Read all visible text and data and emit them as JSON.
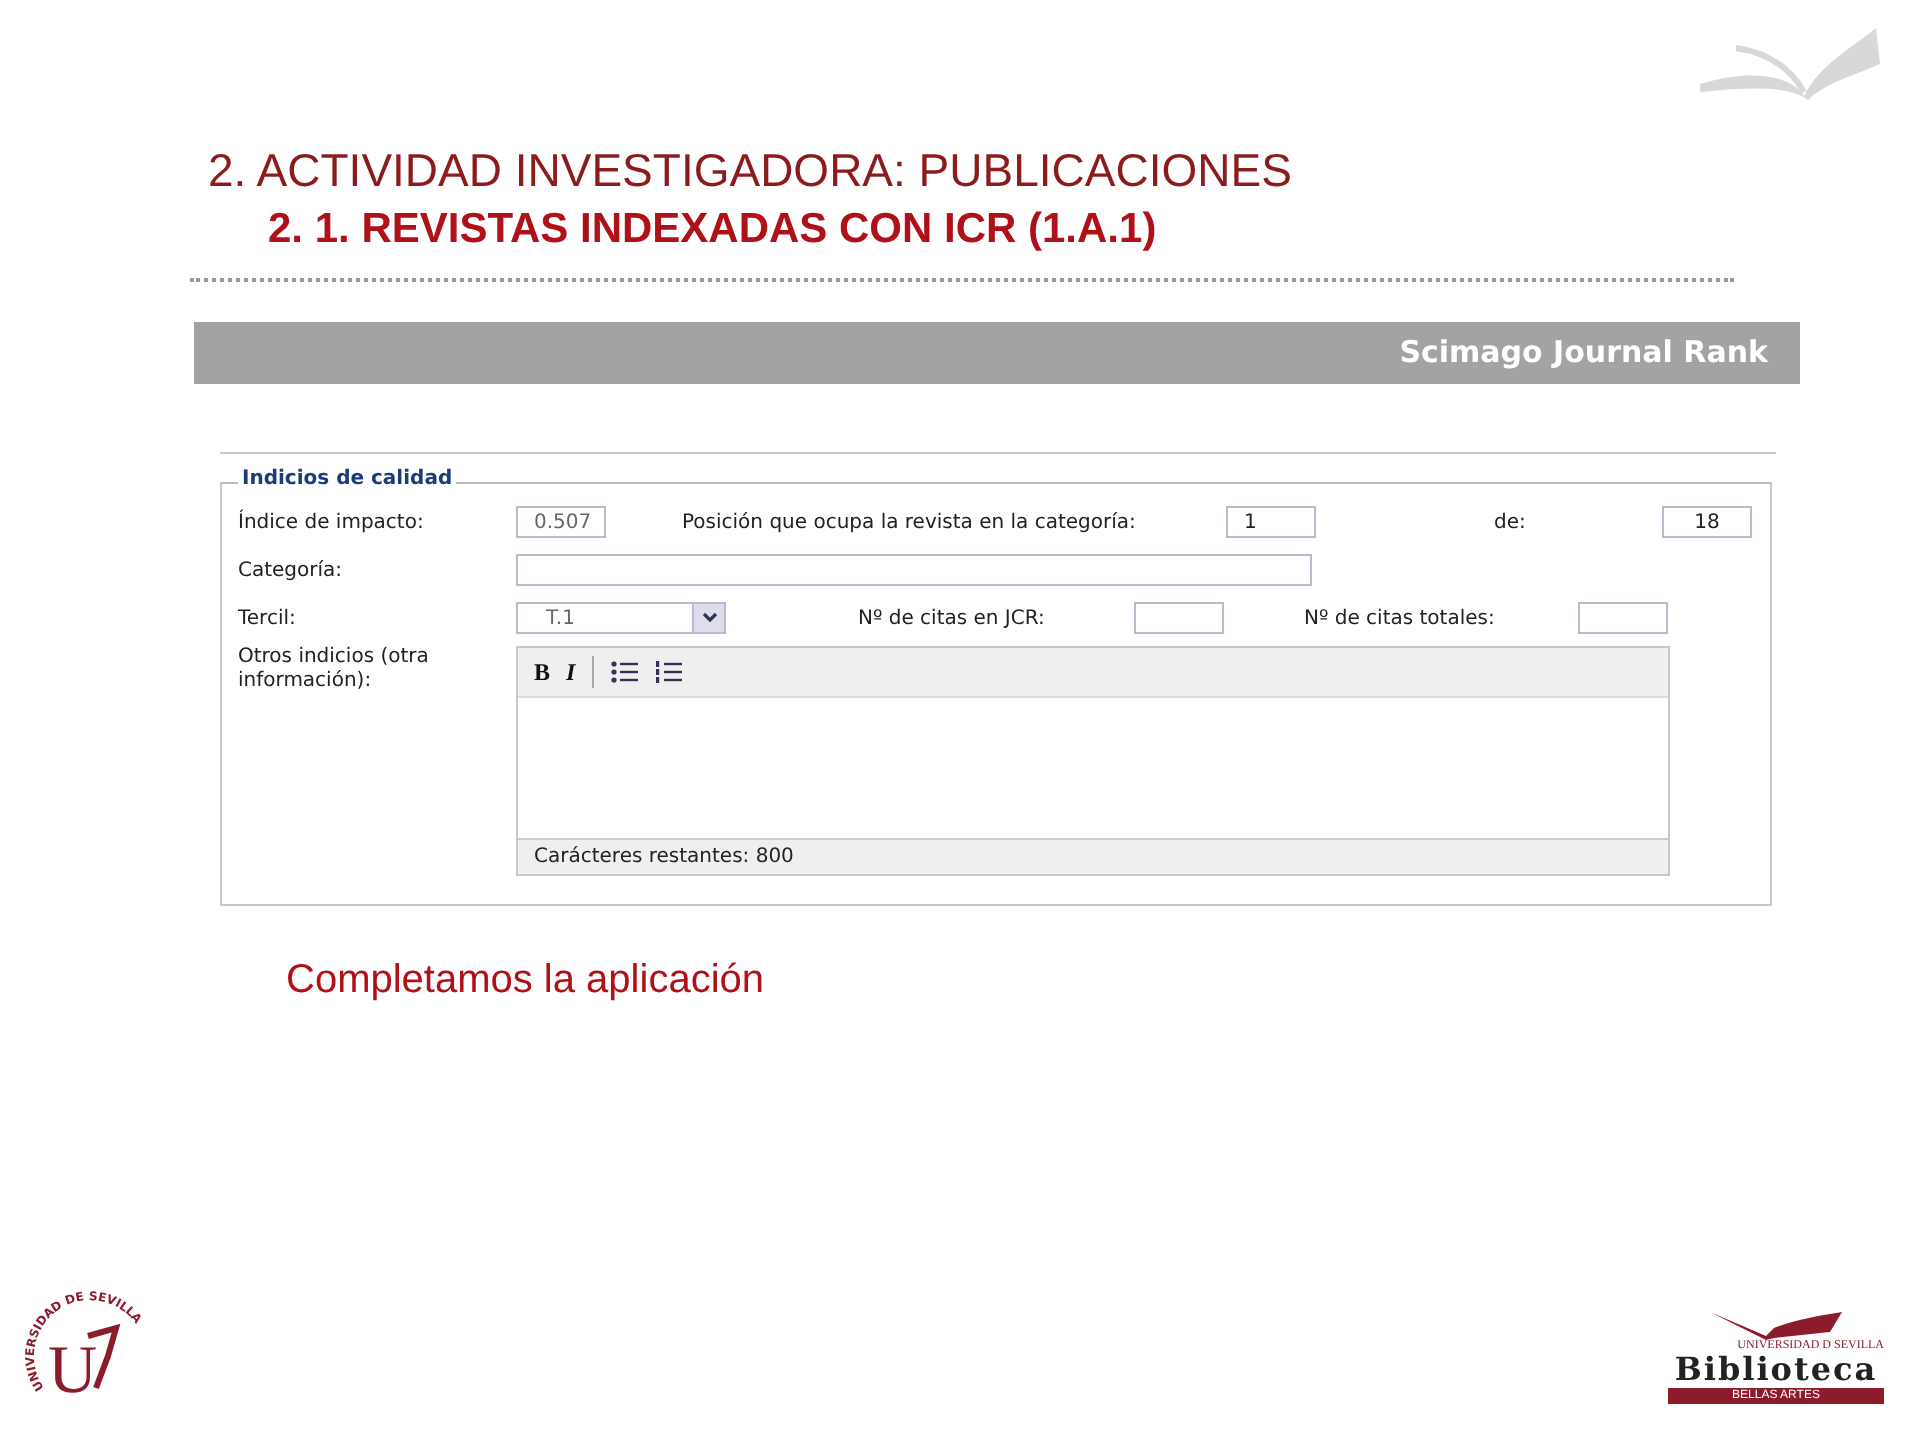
{
  "header": {
    "title": "2. ACTIVIDAD INVESTIGADORA: PUBLICACIONES",
    "subtitle": "2. 1. REVISTAS INDEXADAS CON ICR (1.A.1)"
  },
  "banner": {
    "title": "Scimago Journal Rank"
  },
  "form": {
    "legend": "Indicios de calidad",
    "impact": {
      "label": "Índice de impacto:",
      "value": "0.507"
    },
    "position": {
      "label": "Posición que ocupa la revista en la categoría:",
      "value": "1"
    },
    "total": {
      "label": "de:",
      "value": "18"
    },
    "category": {
      "label": "Categoría:"
    },
    "tercil": {
      "label": "Tercil:",
      "value": "T.1"
    },
    "citations_jcr": {
      "label": "Nº de citas en JCR:"
    },
    "citations_total": {
      "label": "Nº de citas totales:"
    },
    "other": {
      "label": "Otros indicios (otra información):",
      "toolbar": [
        {
          "kind": "bold",
          "label": "B"
        },
        {
          "kind": "italic",
          "label": "I"
        },
        {
          "kind": "bullets"
        },
        {
          "kind": "numbers"
        }
      ],
      "footer": "Carácteres restantes: 800"
    }
  },
  "caption": "Completamos la aplicación",
  "university_logo": {
    "text": "UNIVERSIDAD DE SEVILLA",
    "letter": "U"
  },
  "library_logo": {
    "top": "UNIVERSIDAD D SEVILLA",
    "name": "Biblioteca",
    "sub": "BELLAS ARTES"
  }
}
